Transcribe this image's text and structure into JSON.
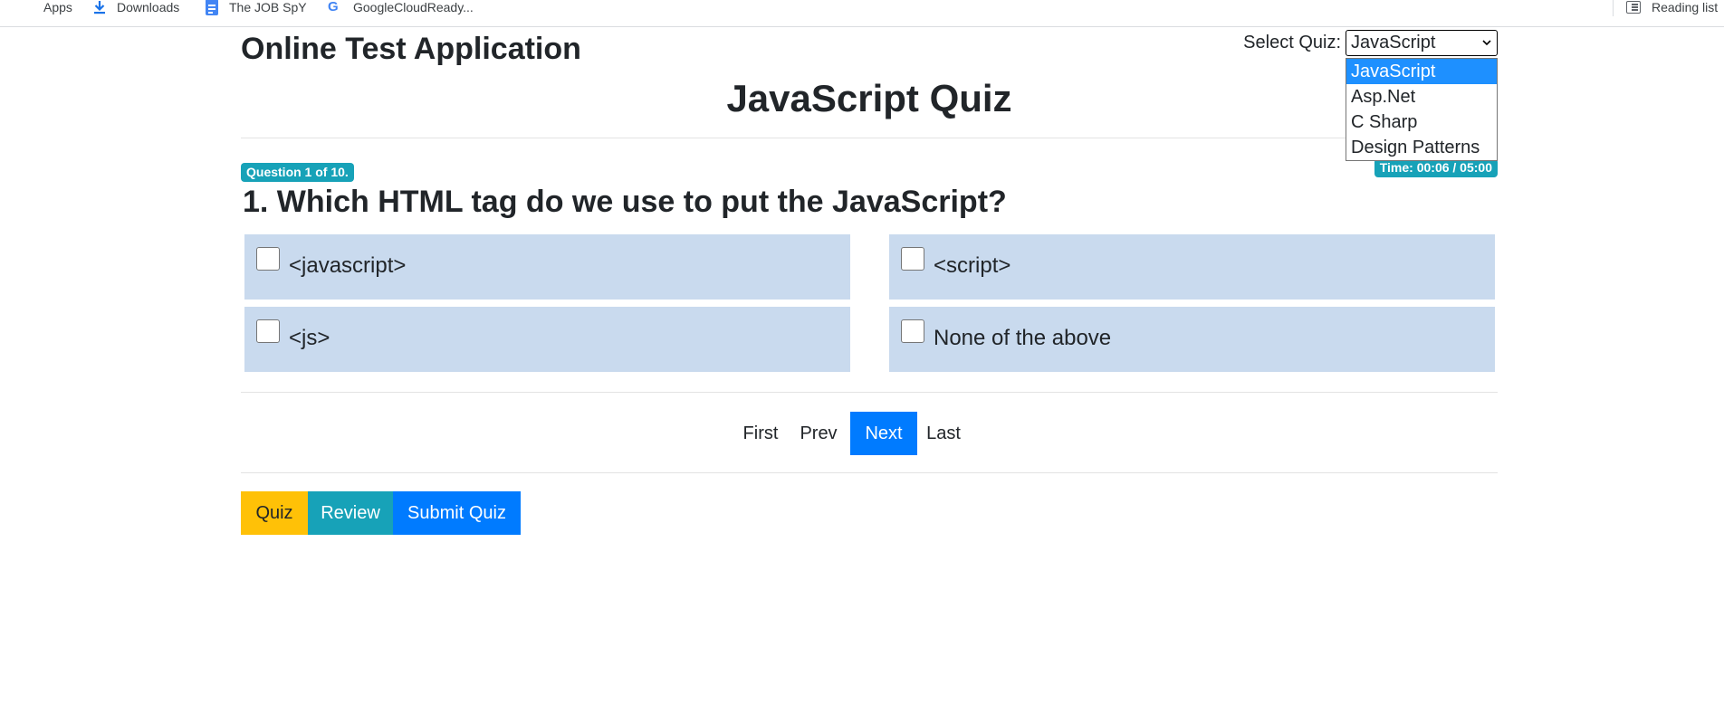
{
  "bookmarks": {
    "items": [
      {
        "label": "Apps",
        "icon": "apps-grid-icon"
      },
      {
        "label": "Downloads",
        "icon": "download-icon"
      },
      {
        "label": "The JOB SpY",
        "icon": "document-icon"
      },
      {
        "label": "GoogleCloudReady...",
        "icon": "google-icon"
      }
    ],
    "reading_list": {
      "label": "Reading list",
      "icon": "reading-list-icon"
    }
  },
  "header": {
    "app_title": "Online Test Application",
    "select_label": "Select Quiz:",
    "selected_quiz": "JavaScript"
  },
  "quiz_dropdown": {
    "options": [
      "JavaScript",
      "Asp.Net",
      "C Sharp",
      "Design Patterns"
    ],
    "selected_index": 0
  },
  "quiz": {
    "title": "JavaScript Quiz",
    "question_badge": "Question 1 of 10.",
    "timer_badge": "Time: 00:06 / 05:00",
    "question": "1. Which HTML tag do we use to put the JavaScript?",
    "options": [
      "<javascript>",
      "<script>",
      "<js>",
      "None of the above"
    ]
  },
  "pagination": {
    "first": "First",
    "prev": "Prev",
    "next": "Next",
    "last": "Last",
    "active": "Next"
  },
  "mode_buttons": {
    "quiz": "Quiz",
    "review": "Review",
    "submit": "Submit Quiz"
  },
  "colors": {
    "primary": "#007bff",
    "info": "#17a2b8",
    "warning": "#ffc107",
    "option_bg": "#c9daee",
    "dropdown_highlight": "#1e90ff"
  }
}
